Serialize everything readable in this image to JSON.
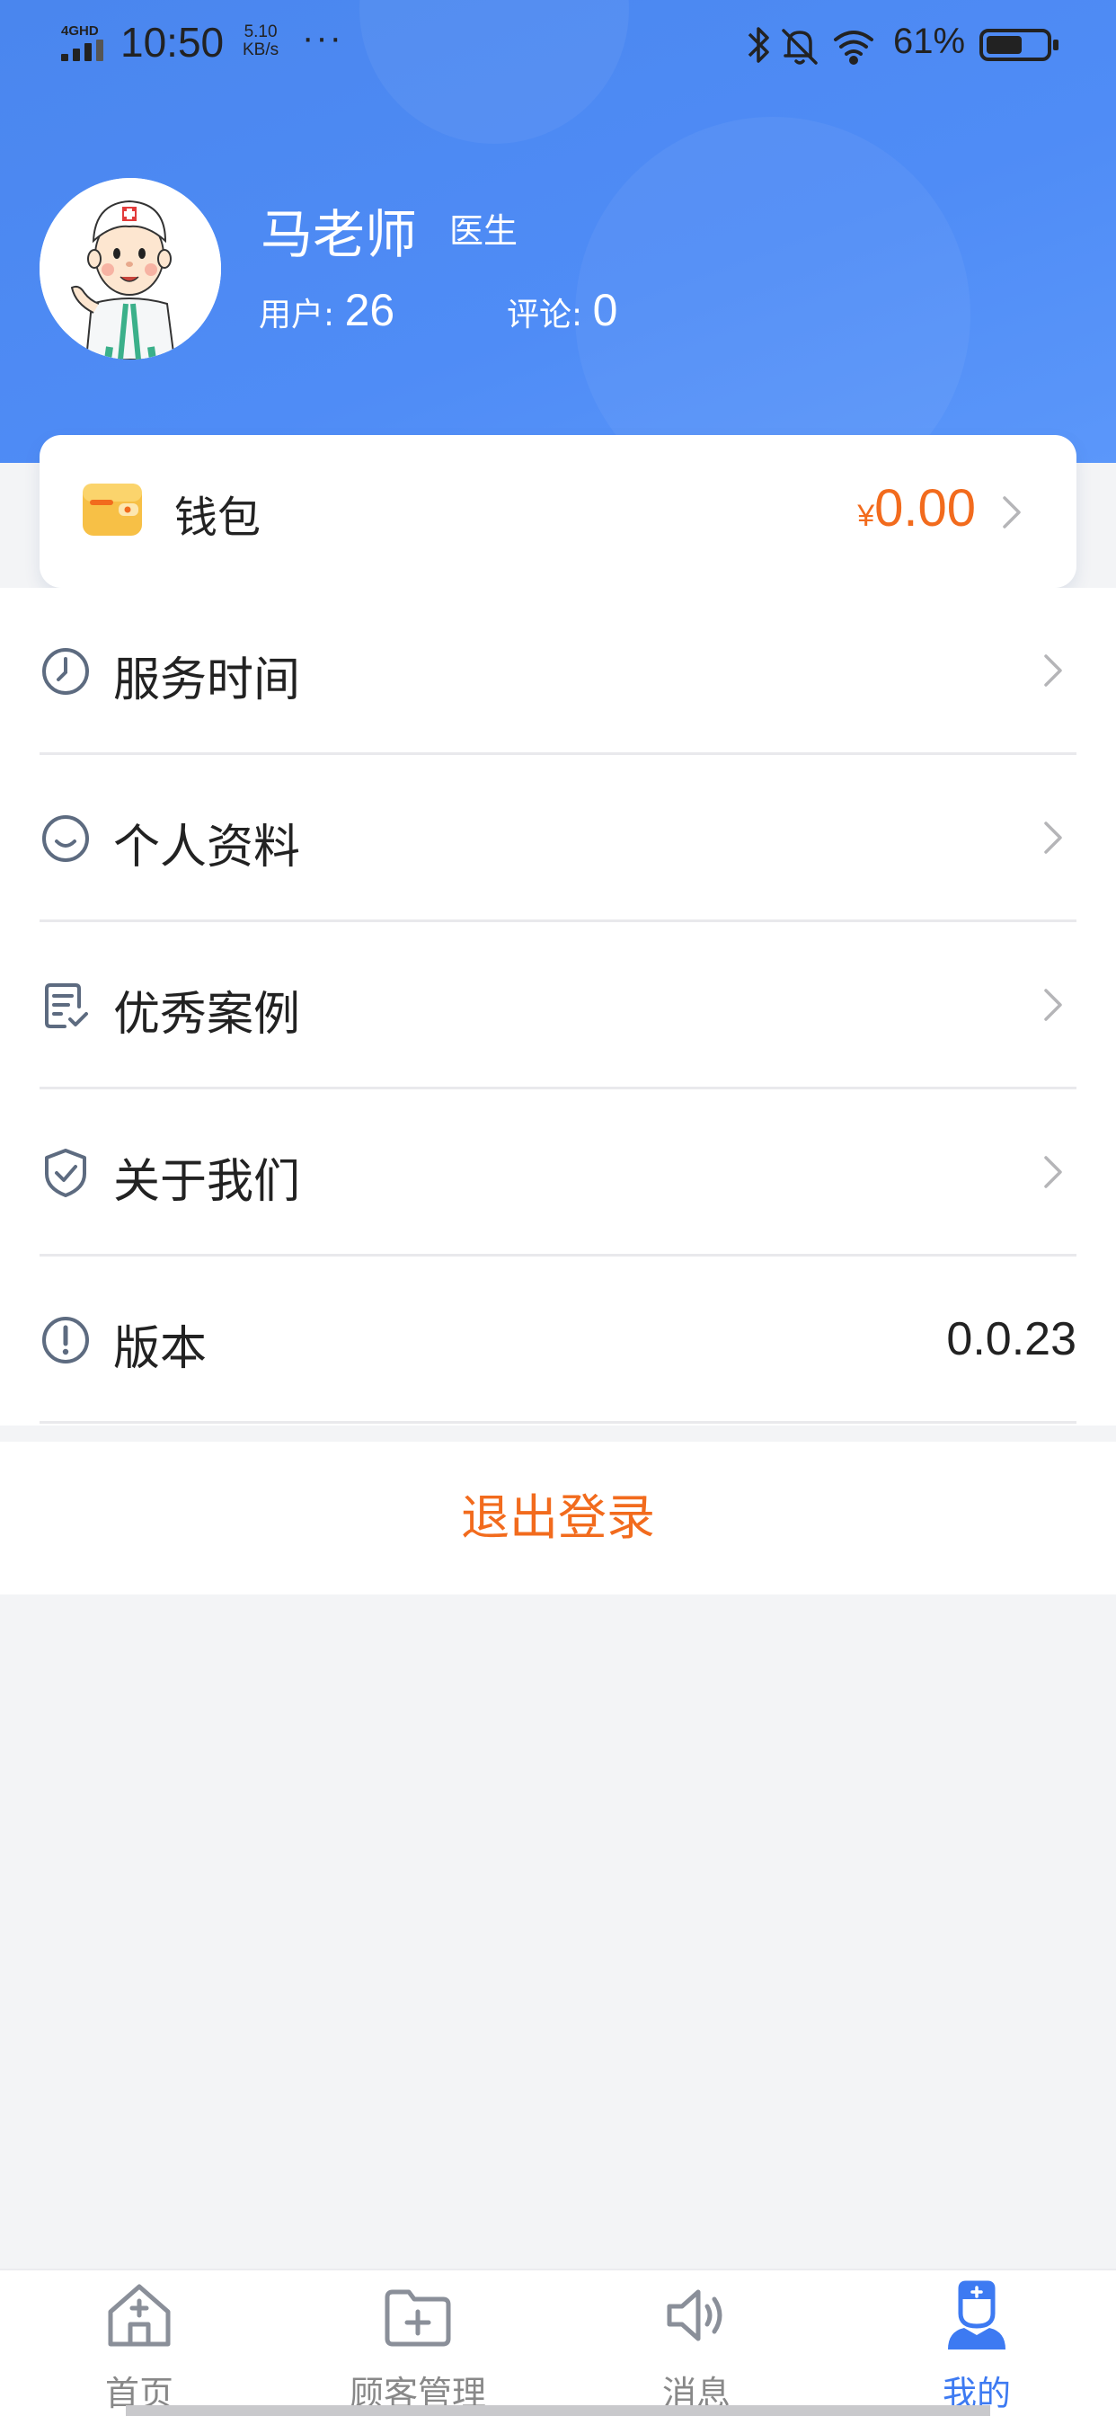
{
  "status_bar": {
    "network": "4GHD",
    "time": "10:50",
    "speed_value": "5.10",
    "speed_unit": "KB/s",
    "more": "···",
    "battery_percent": "61%",
    "battery_level": 0.61
  },
  "profile": {
    "name": "马老师",
    "role": "医生",
    "users_label": "用户: ",
    "users_count": "26",
    "comments_label": "评论: ",
    "comments_count": "0"
  },
  "wallet": {
    "label": "钱包",
    "currency": "¥",
    "amount": "0.00",
    "icon": "wallet-icon"
  },
  "menu": {
    "items": [
      {
        "label": "服务时间",
        "icon": "clock-icon"
      },
      {
        "label": "个人资料",
        "icon": "smile-icon"
      },
      {
        "label": "优秀案例",
        "icon": "document-check-icon"
      },
      {
        "label": "关于我们",
        "icon": "shield-check-icon"
      },
      {
        "label": "版本",
        "icon": "info-icon",
        "value": "0.0.23"
      }
    ]
  },
  "logout": {
    "label": "退出登录"
  },
  "tabbar": {
    "active_color": "#3d7af2",
    "items": [
      {
        "label": "首页",
        "icon": "home-icon"
      },
      {
        "label": "顾客管理",
        "icon": "folder-plus-icon"
      },
      {
        "label": "消息",
        "icon": "speaker-icon"
      },
      {
        "label": "我的",
        "icon": "doctor-icon",
        "active": true
      }
    ]
  },
  "colors": {
    "header": "#4f8cf6",
    "accent_orange": "#f26b1d",
    "background": "#f3f4f6"
  }
}
